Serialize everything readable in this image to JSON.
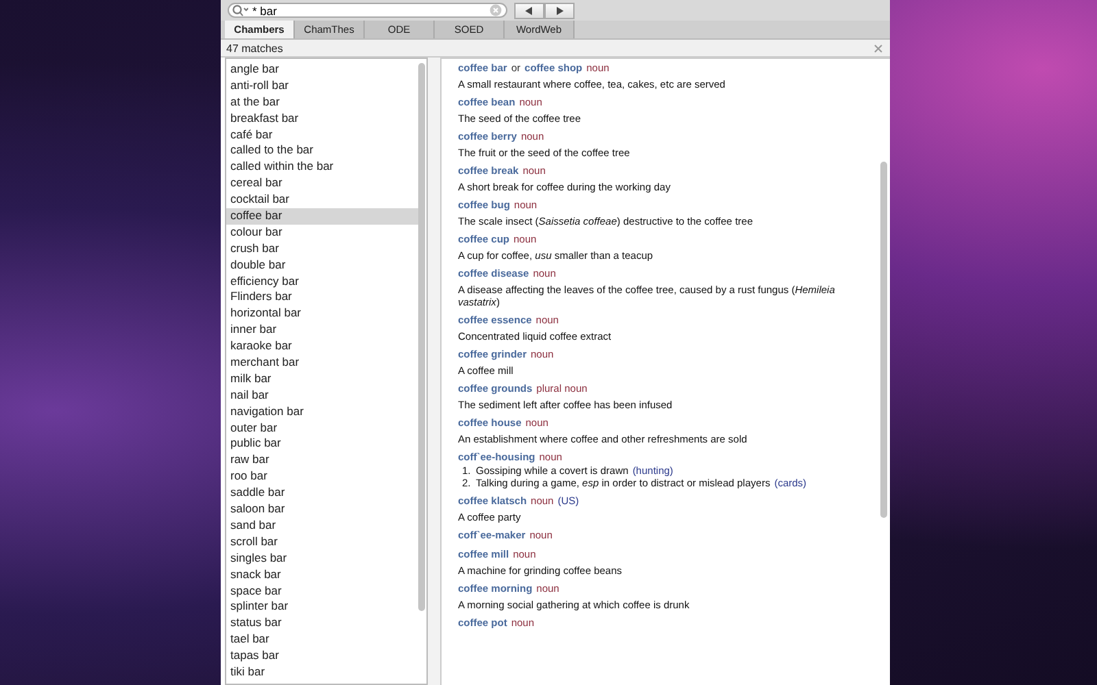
{
  "search": {
    "value": "* bar"
  },
  "tabs": [
    {
      "label": "Chambers",
      "selected": true
    },
    {
      "label": "ChamThes",
      "selected": false
    },
    {
      "label": "ODE",
      "selected": false
    },
    {
      "label": "SOED",
      "selected": false
    },
    {
      "label": "WordWeb",
      "selected": false
    }
  ],
  "match_count": "47 matches",
  "results": [
    {
      "label": "angle bar",
      "selected": false
    },
    {
      "label": "anti-roll bar",
      "selected": false
    },
    {
      "label": "at the bar",
      "selected": false
    },
    {
      "label": "breakfast bar",
      "selected": false
    },
    {
      "label": "café bar",
      "selected": false
    },
    {
      "label": "called to the bar",
      "selected": false
    },
    {
      "label": "called within the bar",
      "selected": false
    },
    {
      "label": "cereal bar",
      "selected": false
    },
    {
      "label": "cocktail bar",
      "selected": false
    },
    {
      "label": "coffee bar",
      "selected": true
    },
    {
      "label": "colour bar",
      "selected": false
    },
    {
      "label": "crush bar",
      "selected": false
    },
    {
      "label": "double bar",
      "selected": false
    },
    {
      "label": "efficiency bar",
      "selected": false
    },
    {
      "label": "Flinders bar",
      "selected": false
    },
    {
      "label": "horizontal bar",
      "selected": false
    },
    {
      "label": "inner bar",
      "selected": false
    },
    {
      "label": "karaoke bar",
      "selected": false
    },
    {
      "label": "merchant bar",
      "selected": false
    },
    {
      "label": "milk bar",
      "selected": false
    },
    {
      "label": "nail bar",
      "selected": false
    },
    {
      "label": "navigation bar",
      "selected": false
    },
    {
      "label": "outer bar",
      "selected": false
    },
    {
      "label": "public bar",
      "selected": false
    },
    {
      "label": "raw bar",
      "selected": false
    },
    {
      "label": "roo bar",
      "selected": false
    },
    {
      "label": "saddle bar",
      "selected": false
    },
    {
      "label": "saloon bar",
      "selected": false
    },
    {
      "label": "sand bar",
      "selected": false
    },
    {
      "label": "scroll bar",
      "selected": false
    },
    {
      "label": "singles bar",
      "selected": false
    },
    {
      "label": "snack bar",
      "selected": false
    },
    {
      "label": "space bar",
      "selected": false
    },
    {
      "label": "splinter bar",
      "selected": false
    },
    {
      "label": "status bar",
      "selected": false
    },
    {
      "label": "tael bar",
      "selected": false
    },
    {
      "label": "tapas bar",
      "selected": false
    },
    {
      "label": "tiki bar",
      "selected": false
    }
  ],
  "entries": [
    {
      "head": [
        {
          "kind": "headword",
          "text": "coffee bar"
        },
        {
          "kind": "plain",
          "text": "or"
        },
        {
          "kind": "headword",
          "text": "coffee shop"
        },
        {
          "kind": "pos",
          "text": "noun"
        }
      ],
      "senses": [
        {
          "text": "A small restaurant where coffee, tea, cakes, etc are served"
        }
      ]
    },
    {
      "head": [
        {
          "kind": "headword",
          "text": "coffee bean"
        },
        {
          "kind": "pos",
          "text": "noun"
        }
      ],
      "senses": [
        {
          "text": "The seed of the coffee tree"
        }
      ]
    },
    {
      "head": [
        {
          "kind": "headword",
          "text": "coffee berry"
        },
        {
          "kind": "pos",
          "text": "noun"
        }
      ],
      "senses": [
        {
          "text": "The fruit or the seed of the coffee tree"
        }
      ]
    },
    {
      "head": [
        {
          "kind": "headword",
          "text": "coffee break"
        },
        {
          "kind": "pos",
          "text": "noun"
        }
      ],
      "senses": [
        {
          "text": "A short break for coffee during the working day"
        }
      ]
    },
    {
      "head": [
        {
          "kind": "headword",
          "text": "coffee bug"
        },
        {
          "kind": "pos",
          "text": "noun"
        }
      ],
      "senses": [
        {
          "text": "The scale insect (*Saissetia coffeae*) destructive to the coffee tree"
        }
      ]
    },
    {
      "head": [
        {
          "kind": "headword",
          "text": "coffee cup"
        },
        {
          "kind": "pos",
          "text": "noun"
        }
      ],
      "senses": [
        {
          "text": "A cup for coffee, *usu* smaller than a teacup"
        }
      ]
    },
    {
      "head": [
        {
          "kind": "headword",
          "text": "coffee disease"
        },
        {
          "kind": "pos",
          "text": "noun"
        }
      ],
      "senses": [
        {
          "text": "A disease affecting the leaves of the coffee tree, caused by a rust fungus (*Hemileia vastatrix*)"
        }
      ]
    },
    {
      "head": [
        {
          "kind": "headword",
          "text": "coffee essence"
        },
        {
          "kind": "pos",
          "text": "noun"
        }
      ],
      "senses": [
        {
          "text": "Concentrated liquid coffee extract"
        }
      ]
    },
    {
      "head": [
        {
          "kind": "headword",
          "text": "coffee grinder"
        },
        {
          "kind": "pos",
          "text": "noun"
        }
      ],
      "senses": [
        {
          "text": "A coffee mill"
        }
      ]
    },
    {
      "head": [
        {
          "kind": "headword",
          "text": "coffee grounds"
        },
        {
          "kind": "pos",
          "text": "plural noun"
        }
      ],
      "senses": [
        {
          "text": "The sediment left after coffee has been infused"
        }
      ]
    },
    {
      "head": [
        {
          "kind": "headword",
          "text": "coffee house"
        },
        {
          "kind": "pos",
          "text": "noun"
        }
      ],
      "senses": [
        {
          "text": "An establishment where coffee and other refreshments are sold"
        }
      ]
    },
    {
      "head": [
        {
          "kind": "headword",
          "text": "coff`ee-housing"
        },
        {
          "kind": "pos",
          "text": "noun"
        }
      ],
      "senses": [
        {
          "number": "1.",
          "text": "Gossiping while a covert is drawn",
          "subject": "(hunting)"
        },
        {
          "number": "2.",
          "text": "Talking during a game, *esp* in order to distract or mislead players",
          "subject": "(cards)"
        }
      ]
    },
    {
      "head": [
        {
          "kind": "headword",
          "text": "coffee klatsch"
        },
        {
          "kind": "pos",
          "text": "noun"
        },
        {
          "kind": "label",
          "text": "(US)"
        }
      ],
      "senses": [
        {
          "text": "A coffee party"
        }
      ]
    },
    {
      "head": [
        {
          "kind": "headword",
          "text": "coff`ee-maker"
        },
        {
          "kind": "pos",
          "text": "noun"
        }
      ]
    },
    {
      "head": [
        {
          "kind": "headword",
          "text": "coffee mill"
        },
        {
          "kind": "pos",
          "text": "noun"
        }
      ],
      "senses": [
        {
          "text": "A machine for grinding coffee beans"
        }
      ]
    },
    {
      "head": [
        {
          "kind": "headword",
          "text": "coffee morning"
        },
        {
          "kind": "pos",
          "text": "noun"
        }
      ],
      "senses": [
        {
          "text": "A morning social gathering at which coffee is drunk"
        }
      ]
    },
    {
      "head": [
        {
          "kind": "headword",
          "text": "coffee pot"
        },
        {
          "kind": "pos",
          "text": "noun"
        }
      ]
    }
  ]
}
